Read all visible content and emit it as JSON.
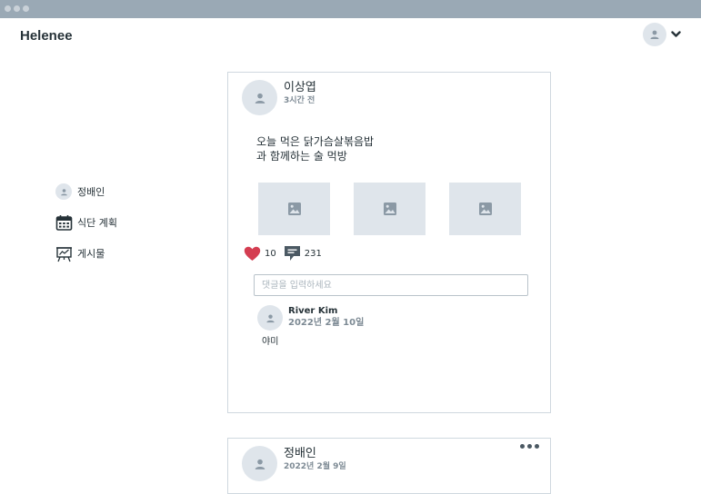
{
  "header": {
    "brand": "Helenee"
  },
  "sidebar": {
    "items": [
      {
        "label": "정배인",
        "icon": "avatar-icon"
      },
      {
        "label": "식단 계획",
        "icon": "calendar-icon"
      },
      {
        "label": "게시물",
        "icon": "presentation-board-icon"
      }
    ]
  },
  "posts": [
    {
      "author": "이상엽",
      "time": "3시간 전",
      "text": "오늘 먹은 닭가슴살볶음밥\n과 함께하는 술 먹방",
      "likes": "10",
      "comments_count": "231",
      "comment_placeholder": "댓글을 입력하세요",
      "comments": [
        {
          "name": "River Kim",
          "date": "2022년 2월 10일",
          "text": "야미"
        }
      ]
    },
    {
      "author": "정배인",
      "time": "2022년 2월 9일"
    }
  ],
  "colors": {
    "titlebar": "#9aa9b5",
    "placeholder": "#dfe5eb",
    "heart": "#d43d51",
    "border": "#cfd8df"
  }
}
